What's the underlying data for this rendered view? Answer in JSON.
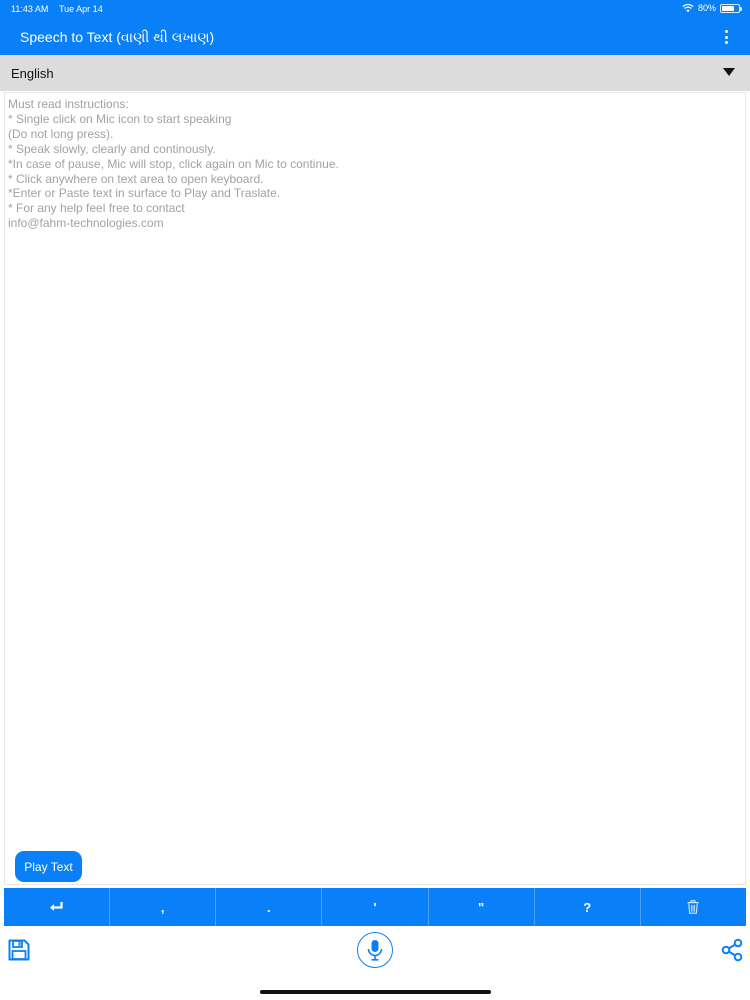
{
  "status_bar": {
    "time": "11:43 AM",
    "date": "Tue Apr 14",
    "battery_text": "80%",
    "battery_level": 0.8
  },
  "app_bar": {
    "title": "Speech to Text (વાણી થી લખાણ)",
    "more_icon": "more-vertical-icon"
  },
  "language": {
    "selected": "English",
    "dropdown_icon": "caret-down-icon"
  },
  "text_area": {
    "placeholder": "Must read instructions:\n* Single click on Mic icon to start speaking\n(Do not long press).\n* Speak slowly, clearly and continously.\n*In case of pause, Mic will stop, click again on Mic to continue.\n* Click anywhere on text area to open keyboard.\n *Enter or Paste text in surface to Play and Traslate.\n* For any help feel free to contact\ninfo@fahm-technologies.com"
  },
  "play_button": {
    "label": "Play Text"
  },
  "punctuation_keys": [
    {
      "label": "↵",
      "icon": "enter-icon"
    },
    {
      "label": ",",
      "icon": ""
    },
    {
      "label": ".",
      "icon": ""
    },
    {
      "label": "'",
      "icon": ""
    },
    {
      "label": "\"",
      "icon": ""
    },
    {
      "label": "?",
      "icon": ""
    },
    {
      "label": "",
      "icon": "trash-icon"
    }
  ],
  "bottom_bar": {
    "save_icon": "save-icon",
    "mic_icon": "mic-icon",
    "share_icon": "share-icon"
  },
  "colors": {
    "accent": "#0a80f8",
    "language_bar": "#dcdcdc",
    "placeholder_text": "#a2a2a2"
  }
}
